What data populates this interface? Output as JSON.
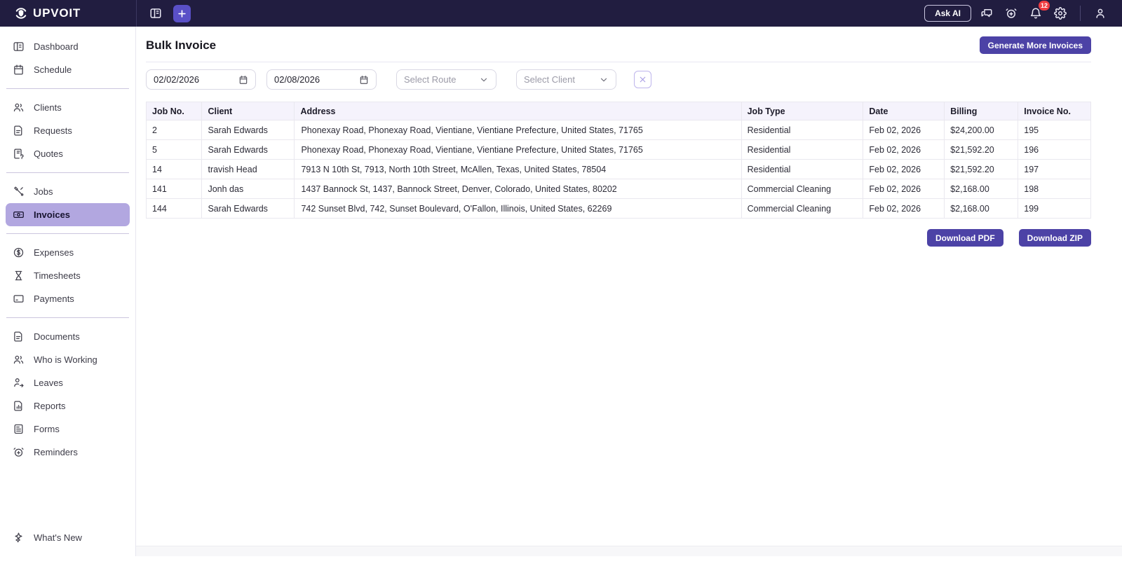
{
  "topbar": {
    "brand": "UPVOIT",
    "ask_ai_label": "Ask AI",
    "notification_count": "12"
  },
  "sidebar": {
    "sections": [
      {
        "items": [
          {
            "label": "Dashboard",
            "icon": "dashboard"
          },
          {
            "label": "Schedule",
            "icon": "calendar"
          }
        ]
      },
      {
        "items": [
          {
            "label": "Clients",
            "icon": "users"
          },
          {
            "label": "Requests",
            "icon": "file-text"
          },
          {
            "label": "Quotes",
            "icon": "clipboard-question"
          }
        ]
      },
      {
        "items": [
          {
            "label": "Jobs",
            "icon": "tools"
          },
          {
            "label": "Invoices",
            "icon": "banknote",
            "active": true
          }
        ]
      },
      {
        "items": [
          {
            "label": "Expenses",
            "icon": "dollar-circle"
          },
          {
            "label": "Timesheets",
            "icon": "hourglass"
          },
          {
            "label": "Payments",
            "icon": "credit-card"
          }
        ]
      },
      {
        "items": [
          {
            "label": "Documents",
            "icon": "file-text"
          },
          {
            "label": "Who is Working",
            "icon": "users"
          },
          {
            "label": "Leaves",
            "icon": "user-arrow"
          },
          {
            "label": "Reports",
            "icon": "file-chart"
          },
          {
            "label": "Forms",
            "icon": "form"
          },
          {
            "label": "Reminders",
            "icon": "alarm-plus"
          }
        ]
      }
    ],
    "footer_item": {
      "label": "What's New",
      "icon": "sparkle"
    }
  },
  "page": {
    "title": "Bulk Invoice",
    "generate_button": "Generate More Invoices",
    "download_pdf": "Download PDF",
    "download_zip": "Download ZIP"
  },
  "filters": {
    "date_from": "02/02/2026",
    "date_to": "02/08/2026",
    "route_placeholder": "Select Route",
    "client_placeholder": "Select Client"
  },
  "table": {
    "columns": [
      "Job No.",
      "Client",
      "Address",
      "Job Type",
      "Date",
      "Billing",
      "Invoice No."
    ],
    "col_widths": [
      "5.9%",
      "9.8%",
      "47.3%",
      "12.9%",
      "8.6%",
      "7.8%",
      "7.7%"
    ],
    "rows": [
      [
        "2",
        "Sarah Edwards",
        "Phonexay Road, Phonexay Road, Vientiane, Vientiane Prefecture, United States, 71765",
        "Residential",
        "Feb 02, 2026",
        "$24,200.00",
        "195"
      ],
      [
        "5",
        "Sarah Edwards",
        "Phonexay Road, Phonexay Road, Vientiane, Vientiane Prefecture, United States, 71765",
        "Residential",
        "Feb 02, 2026",
        "$21,592.20",
        "196"
      ],
      [
        "14",
        "travish Head",
        "7913 N 10th St, 7913, North 10th Street, McAllen, Texas, United States, 78504",
        "Residential",
        "Feb 02, 2026",
        "$21,592.20",
        "197"
      ],
      [
        "141",
        "Jonh das",
        "1437 Bannock St, 1437, Bannock Street, Denver, Colorado, United States, 80202",
        "Commercial Cleaning",
        "Feb 02, 2026",
        "$2,168.00",
        "198"
      ],
      [
        "144",
        "Sarah Edwards",
        "742 Sunset Blvd, 742, Sunset Boulevard, O'Fallon, Illinois, United States, 62269",
        "Commercial Cleaning",
        "Feb 02, 2026",
        "$2,168.00",
        "199"
      ]
    ]
  },
  "colors": {
    "topbar_bg": "#211d40",
    "accent_purple": "#4c42a6",
    "plus_button": "#5a50c7",
    "active_item_bg": "#b2a7e0",
    "badge_red": "#ee3d42",
    "table_header_bg": "#f5f3fc"
  }
}
